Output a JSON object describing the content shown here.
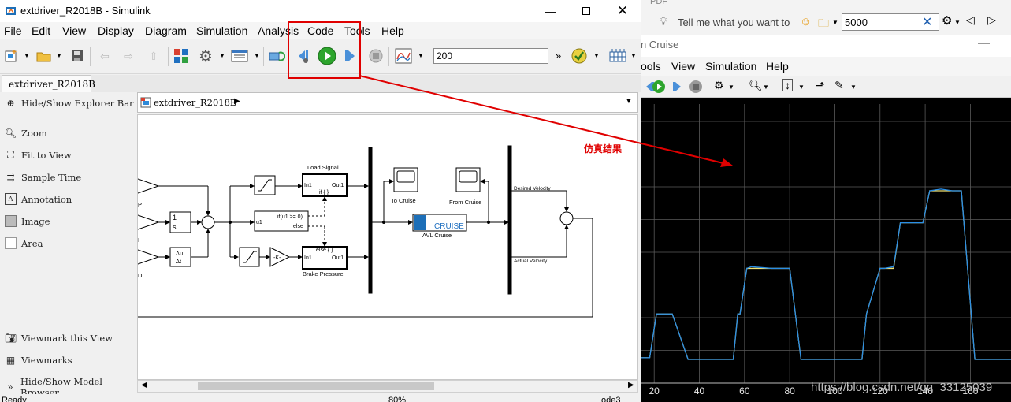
{
  "simulink": {
    "title": "extdriver_R2018B - Simulink",
    "menu": [
      "File",
      "Edit",
      "View",
      "Display",
      "Diagram",
      "Simulation",
      "Analysis",
      "Code",
      "Tools",
      "Help"
    ],
    "stop_time": "200",
    "tab": "extdriver_R2018B",
    "breadcrumb": "extdriver_R2018B",
    "left_panel": {
      "top": [
        "Hide/Show Explorer Bar"
      ],
      "tools": [
        "Zoom",
        "Fit to View",
        "Sample Time",
        "Annotation",
        "Image",
        "Area"
      ],
      "bottom": [
        "Viewmark this View",
        "Viewmarks",
        "Hide/Show Model Browser"
      ]
    },
    "diagram": {
      "load_signal": "Load Signal",
      "in1": "In1",
      "out1": "Out1",
      "if_action": "if { }",
      "else_action": "else { }",
      "if_cond": "if(u1 >= 0)",
      "u1": "u1",
      "else_label": "else",
      "brake_pressure": "Brake Pressure",
      "gain": "-K-",
      "integrator_num": "1",
      "integrator_den": "s",
      "deriv_num": "Δu",
      "deriv_den": "Δt",
      "to_cruise": "To Cruise",
      "from_cruise": "From Cruise",
      "avl_logo": "CRUISE",
      "avl_cruise": "AVL Cruise",
      "desired_velocity": "Desired Velocity",
      "actual_velocity": "Actual Velocity",
      "p_label": "P",
      "i_label": "I",
      "d_label": "D",
      "annotation": "仿真结果"
    },
    "status": {
      "left": "Ready",
      "zoom": "80%",
      "solver": "ode3"
    }
  },
  "word": {
    "tell_me": "Tell me what you want to",
    "search_value": "5000",
    "pdf": "PDF"
  },
  "scope": {
    "title": "n Cruise",
    "menu": [
      "ools",
      "View",
      "Simulation",
      "Help"
    ],
    "watermark": "https://blog.csdn.net/qq_33125039"
  },
  "chart_data": {
    "type": "line",
    "title": "",
    "x_ticks": [
      20,
      40,
      60,
      80,
      100,
      120,
      140,
      160
    ],
    "xlim": [
      14,
      178
    ],
    "ylim": [
      0,
      1
    ],
    "grid": true,
    "series": [
      {
        "color": "#f0e070",
        "x": [
          14,
          18,
          21,
          26,
          28,
          35,
          50,
          55,
          57,
          58,
          61,
          63,
          72,
          80,
          85,
          98,
          106,
          112,
          114,
          120,
          122,
          126,
          129,
          133,
          135,
          139,
          142,
          147,
          152,
          156,
          162,
          178
        ],
        "y": [
          0.01,
          0.01,
          0.27,
          0.27,
          0.27,
          0.0,
          0.0,
          0.0,
          0.27,
          0.27,
          0.54,
          0.54,
          0.54,
          0.54,
          0.0,
          0.0,
          0.0,
          0.0,
          0.27,
          0.54,
          0.54,
          0.54,
          0.81,
          0.81,
          0.81,
          0.81,
          1.0,
          1.0,
          1.0,
          1.0,
          0.0,
          0.0
        ]
      },
      {
        "color": "#2a8ee6",
        "x": [
          14,
          18,
          21,
          26,
          28,
          35,
          50,
          55,
          57,
          58,
          61,
          63,
          72,
          80,
          85,
          98,
          106,
          112,
          114,
          120,
          122,
          126,
          129,
          133,
          135,
          139,
          142,
          147,
          152,
          156,
          162,
          178
        ],
        "y": [
          0.01,
          0.01,
          0.27,
          0.27,
          0.27,
          0.0,
          0.0,
          0.0,
          0.27,
          0.27,
          0.54,
          0.55,
          0.54,
          0.54,
          0.0,
          0.0,
          0.0,
          0.0,
          0.27,
          0.54,
          0.54,
          0.55,
          0.81,
          0.81,
          0.81,
          0.81,
          1.0,
          1.01,
          1.0,
          1.0,
          0.0,
          0.0
        ]
      }
    ]
  }
}
